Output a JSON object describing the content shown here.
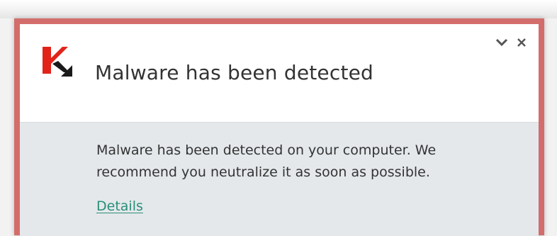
{
  "notification": {
    "title": "Malware has been detected",
    "message": "Malware has been detected on your computer. We recommend you neutralize it as soon as possible.",
    "details_link": "Details",
    "icons": {
      "logo": "kaspersky-logo-icon",
      "collapse": "chevron-down-icon",
      "close": "close-icon"
    },
    "colors": {
      "border": "#d36d6b",
      "logo_red": "#e2231a",
      "link": "#2a8f79",
      "body_background": "#e4e8eb"
    }
  }
}
